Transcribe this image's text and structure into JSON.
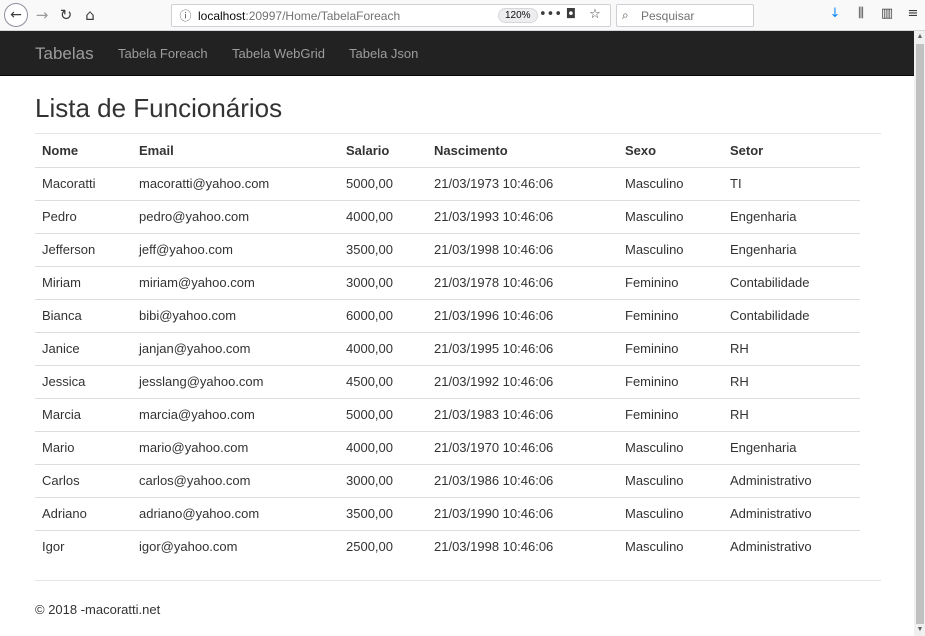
{
  "browser": {
    "back_glyph": "←",
    "forward_glyph": "→",
    "reload_glyph": "↻",
    "home_glyph": "⌂",
    "url_host": "localhost",
    "url_rest": ":20997/Home/TabelaForeach",
    "zoom": "120%",
    "more_glyph": "•••",
    "pocket_glyph": "◘",
    "bookmark_glyph": "☆",
    "search_placeholder": "Pesquisar",
    "search_glyph": "⌕",
    "download_glyph": "↓",
    "library_glyph": "⫼",
    "sidebar_glyph": "▥",
    "menu_glyph": "≡",
    "info_glyph": "ⓘ"
  },
  "navbar": {
    "brand": "Tabelas",
    "links": [
      "Tabela Foreach",
      "Tabela WebGrid",
      "Tabela Json"
    ]
  },
  "page": {
    "title": "Lista de Funcionários"
  },
  "table": {
    "headers": [
      "Nome",
      "Email",
      "Salario",
      "Nascimento",
      "Sexo",
      "Setor"
    ],
    "rows": [
      [
        "Macoratti",
        "macoratti@yahoo.com",
        "5000,00",
        "21/03/1973 10:46:06",
        "Masculino",
        "TI"
      ],
      [
        "Pedro",
        "pedro@yahoo.com",
        "4000,00",
        "21/03/1993 10:46:06",
        "Masculino",
        "Engenharia"
      ],
      [
        "Jefferson",
        "jeff@yahoo.com",
        "3500,00",
        "21/03/1998 10:46:06",
        "Masculino",
        "Engenharia"
      ],
      [
        "Miriam",
        "miriam@yahoo.com",
        "3000,00",
        "21/03/1978 10:46:06",
        "Feminino",
        "Contabilidade"
      ],
      [
        "Bianca",
        "bibi@yahoo.com",
        "6000,00",
        "21/03/1996 10:46:06",
        "Feminino",
        "Contabilidade"
      ],
      [
        "Janice",
        "janjan@yahoo.com",
        "4000,00",
        "21/03/1995 10:46:06",
        "Feminino",
        "RH"
      ],
      [
        "Jessica",
        "jesslang@yahoo.com",
        "4500,00",
        "21/03/1992 10:46:06",
        "Feminino",
        "RH"
      ],
      [
        "Marcia",
        "marcia@yahoo.com",
        "5000,00",
        "21/03/1983 10:46:06",
        "Feminino",
        "RH"
      ],
      [
        "Mario",
        "mario@yahoo.com",
        "4000,00",
        "21/03/1970 10:46:06",
        "Masculino",
        "Engenharia"
      ],
      [
        "Carlos",
        "carlos@yahoo.com",
        "3000,00",
        "21/03/1986 10:46:06",
        "Masculino",
        "Administrativo"
      ],
      [
        "Adriano",
        "adriano@yahoo.com",
        "3500,00",
        "21/03/1990 10:46:06",
        "Masculino",
        "Administrativo"
      ],
      [
        "Igor",
        "igor@yahoo.com",
        "2500,00",
        "21/03/1998 10:46:06",
        "Masculino",
        "Administrativo"
      ]
    ]
  },
  "footer": {
    "text": "© 2018 -macoratti.net"
  },
  "colors": {
    "navbar_bg": "#222222",
    "navbar_text": "#9d9d9d",
    "download_accent": "#0a84ff"
  }
}
